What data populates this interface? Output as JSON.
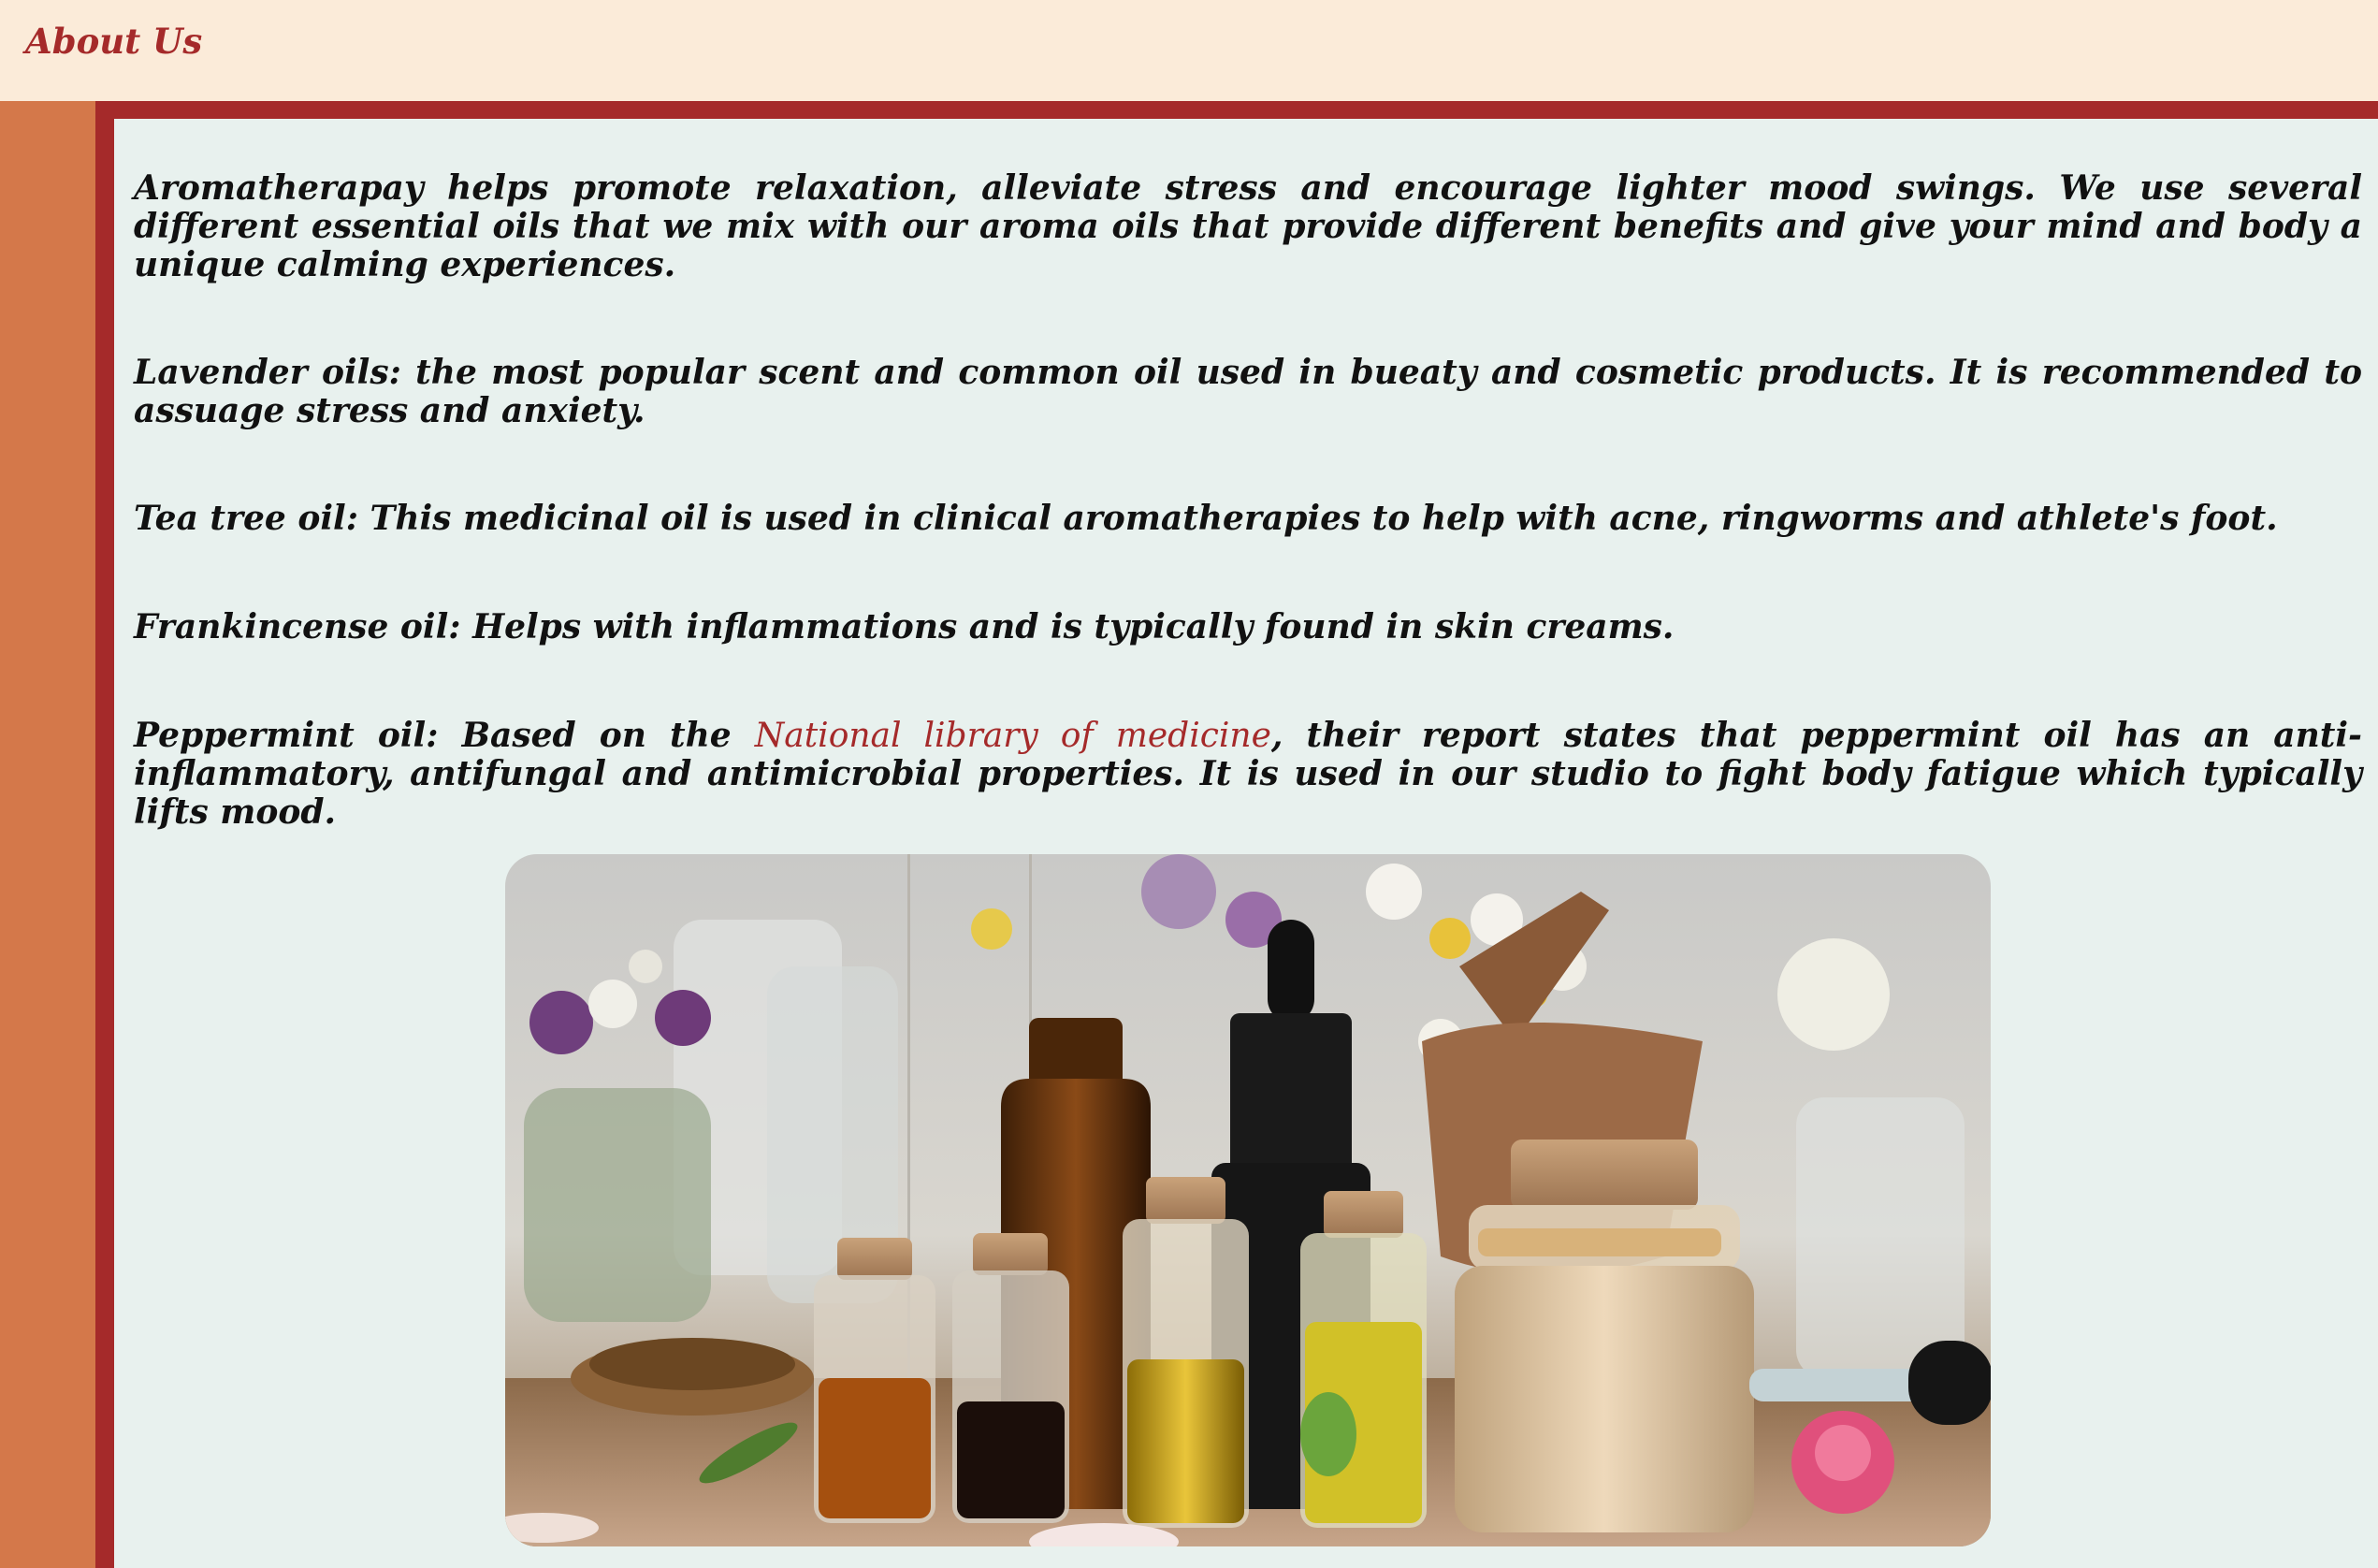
{
  "header": {
    "title": "About Us"
  },
  "colors": {
    "header_bg": "#fbebd9",
    "title": "#a52a2a",
    "sidebar": "#d4784a",
    "border": "#a52a2a",
    "content_bg": "#e8f1ee",
    "link": "#a52a2a"
  },
  "paragraphs": {
    "intro": "Aromatherapay helps promote relaxation, alleviate stress and encourage lighter mood swings. We use several different essential oils that we mix with our aroma oils that provide different benefits and give your mind and body a unique calming experiences.",
    "lavender": "Lavender oils: the most popular scent and common oil used in bueaty and cosmetic products. It is recommended to assuage stress and anxiety.",
    "tea_tree": "Tea tree oil: This medicinal oil is used in clinical aromatherapies to help with acne, ringworms and athlete's foot.",
    "frankincense": "Frankincense oil: Helps with inflammations and is typically found in skin creams.",
    "peppermint_before": "Peppermint oil: Based on the ",
    "peppermint_link": "National library of medicine",
    "peppermint_after": ", their report states that peppermint oil has an anti-inflammatory, antifungal and antimicrobial properties. It is used in our studio to fight body fatigue which typically lifts mood."
  },
  "image": {
    "icon": "essential-oils-photo"
  }
}
